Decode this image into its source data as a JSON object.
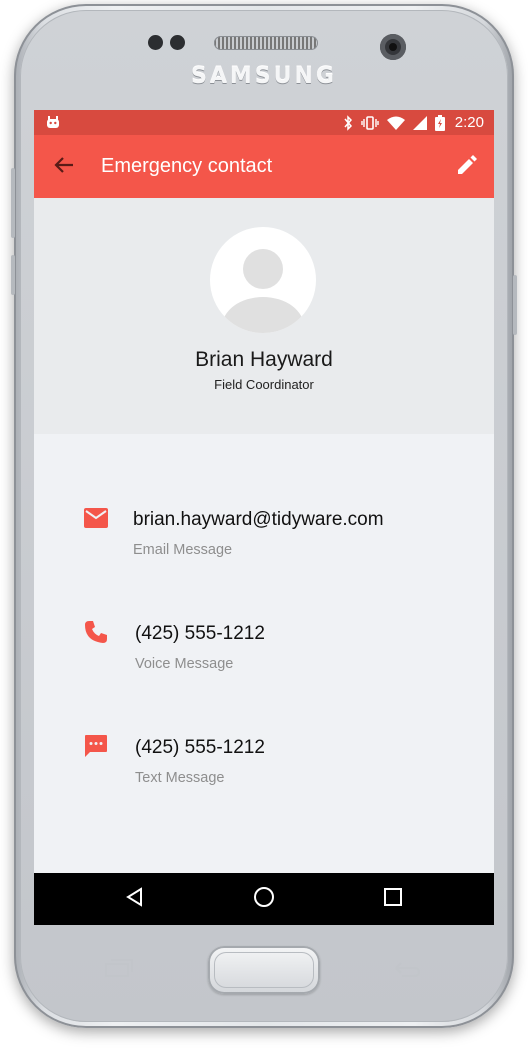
{
  "device": {
    "brand": "SAMSUNG"
  },
  "status_bar": {
    "time": "2:20",
    "icons": [
      "android-icon",
      "bluetooth-icon",
      "vibrate-icon",
      "wifi-icon",
      "signal-icon",
      "battery-icon"
    ]
  },
  "app_bar": {
    "title": "Emergency contact",
    "back_icon": "arrow-back-icon",
    "edit_icon": "pencil-icon"
  },
  "profile": {
    "name": "Brian Hayward",
    "role": "Field Coordinator"
  },
  "contacts": [
    {
      "icon": "email-icon",
      "value": "brian.hayward@tidyware.com",
      "type": "Email Message"
    },
    {
      "icon": "phone-icon",
      "value": "(425) 555-1212",
      "type": "Voice Message"
    },
    {
      "icon": "message-icon",
      "value": "(425) 555-1212",
      "type": "Text Message"
    }
  ],
  "nav_bar": {
    "icons": [
      "back-triangle-icon",
      "home-circle-icon",
      "recents-square-icon"
    ]
  },
  "colors": {
    "status_bar": "#d84a3f",
    "app_bar": "#f4564a",
    "accent_icon": "#f4564a",
    "profile_bg": "#e9ebed",
    "content_bg": "#f0f2f5"
  }
}
